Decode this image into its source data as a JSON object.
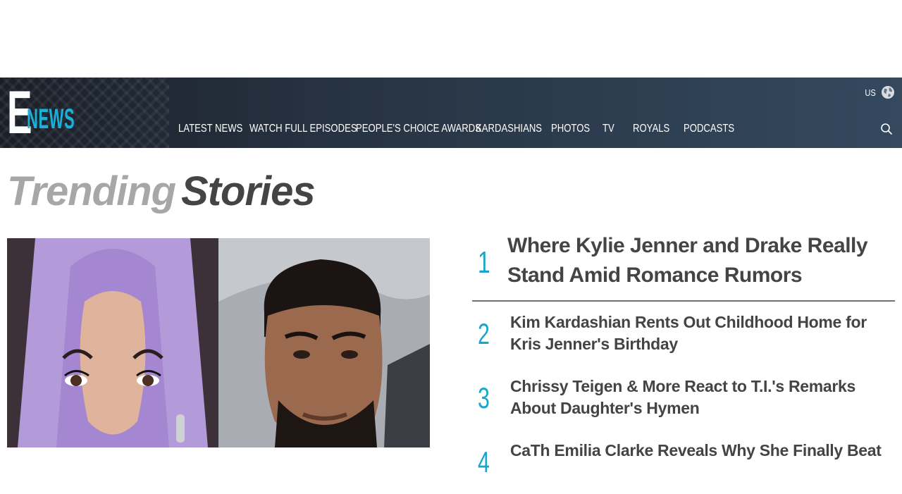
{
  "header": {
    "logo": {
      "e": "E",
      "news": "NEWS"
    },
    "region": "US",
    "nav": [
      "LATEST NEWS",
      "WATCH FULL EPISODES",
      "PEOPLE'S CHOICE AWARDS",
      "KARDASHIANS",
      "PHOTOS",
      "TV",
      "ROYALS",
      "PODCASTS"
    ]
  },
  "trending": {
    "word1": "Trending",
    "word2": "Stories"
  },
  "stories": [
    {
      "rank": "1",
      "title": "Where Kylie Jenner and Drake Really Stand Amid Romance Rumors"
    },
    {
      "rank": "2",
      "title": "Kim Kardashian Rents Out Childhood Home for Kris Jenner's Birthday"
    },
    {
      "rank": "3",
      "title": "Chrissy Teigen & More React to T.I.'s Remarks About Daughter's Hymen"
    },
    {
      "rank": "4",
      "title": "CaTh Emilia Clarke Reveals Why She Finally Beat"
    }
  ],
  "colors": {
    "accent": "#1ab0d8",
    "header_bg": "#263241",
    "text_dark": "#444444",
    "text_light": "#a7a7a7"
  }
}
